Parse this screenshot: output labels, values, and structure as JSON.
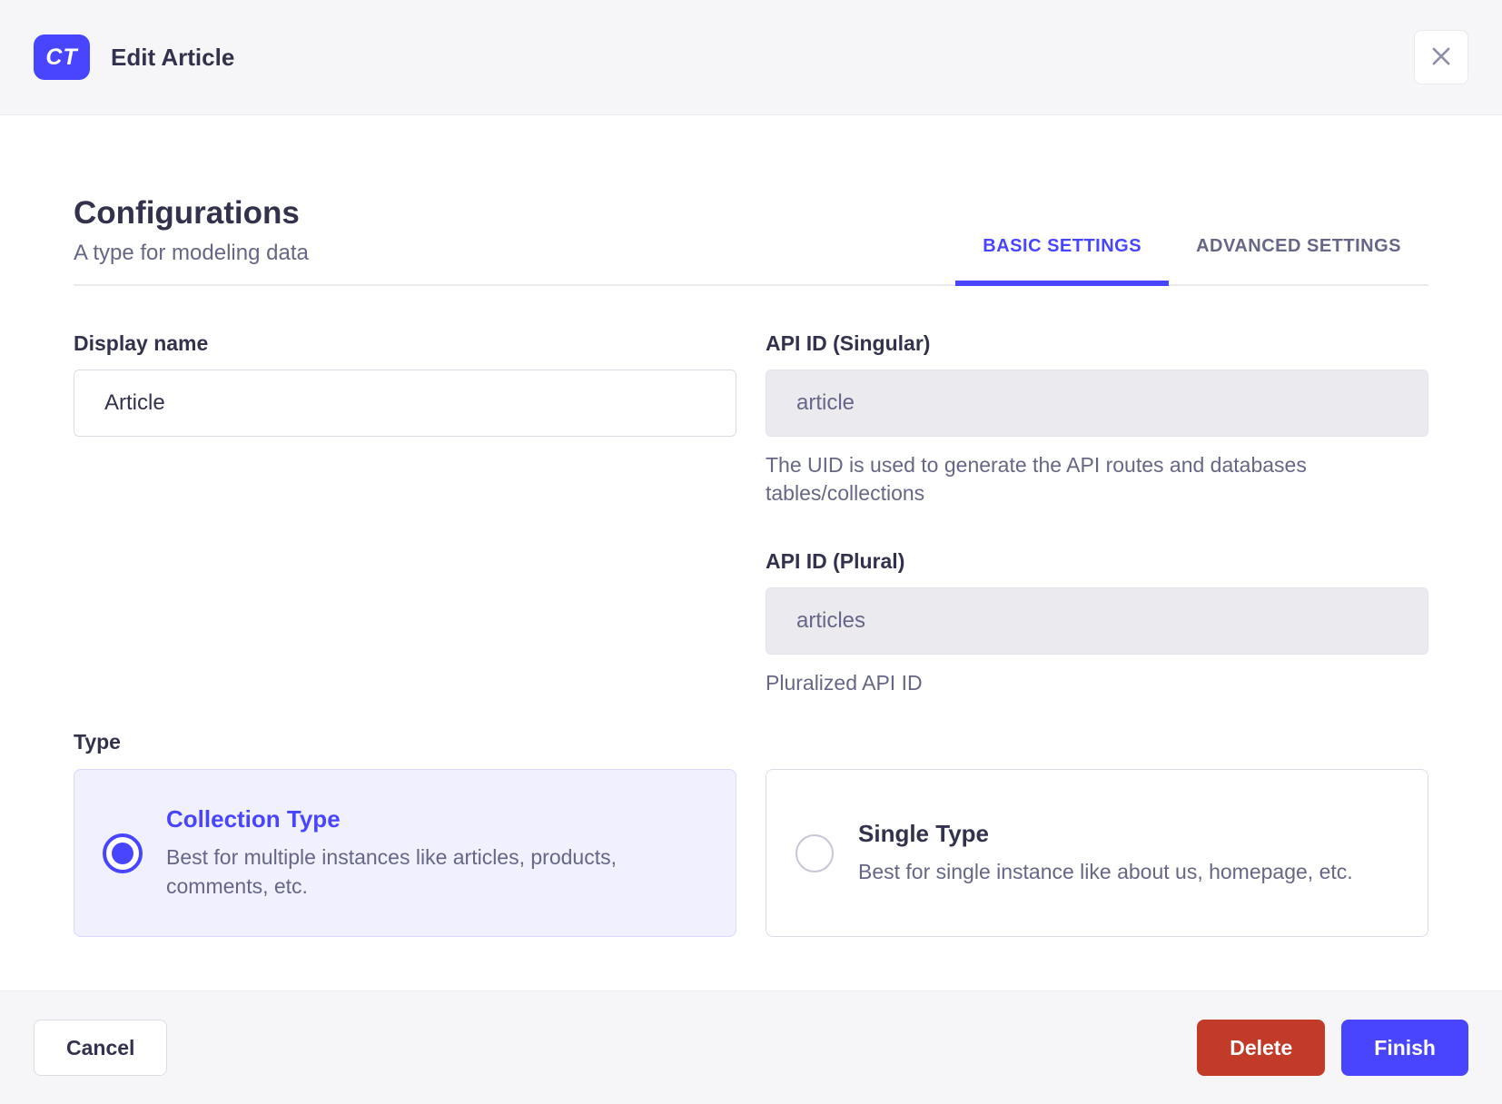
{
  "header": {
    "badge_label": "CT",
    "title": "Edit Article"
  },
  "config": {
    "title": "Configurations",
    "subtitle": "A type for modeling data"
  },
  "tabs": [
    {
      "label": "BASIC SETTINGS",
      "active": true
    },
    {
      "label": "ADVANCED SETTINGS",
      "active": false
    }
  ],
  "fields": {
    "display_name": {
      "label": "Display name",
      "value": "Article"
    },
    "api_id_singular": {
      "label": "API ID (Singular)",
      "value": "article",
      "helper": "The UID is used to generate the API routes and databases tables/collections"
    },
    "api_id_plural": {
      "label": "API ID (Plural)",
      "value": "articles",
      "helper": "Pluralized API ID"
    }
  },
  "type_section": {
    "label": "Type",
    "options": [
      {
        "title": "Collection Type",
        "description": "Best for multiple instances like articles, products, comments, etc.",
        "selected": true
      },
      {
        "title": "Single Type",
        "description": "Best for single instance like about us, homepage, etc.",
        "selected": false
      }
    ]
  },
  "footer": {
    "cancel_label": "Cancel",
    "delete_label": "Delete",
    "finish_label": "Finish"
  },
  "colors": {
    "primary": "#4945ff",
    "danger": "#c23a28",
    "selected_card_bg": "#f0f0ff",
    "surface_gray": "#f6f6f9",
    "border": "#eaeaef",
    "text_dark": "#32324d",
    "text_muted": "#666687"
  }
}
